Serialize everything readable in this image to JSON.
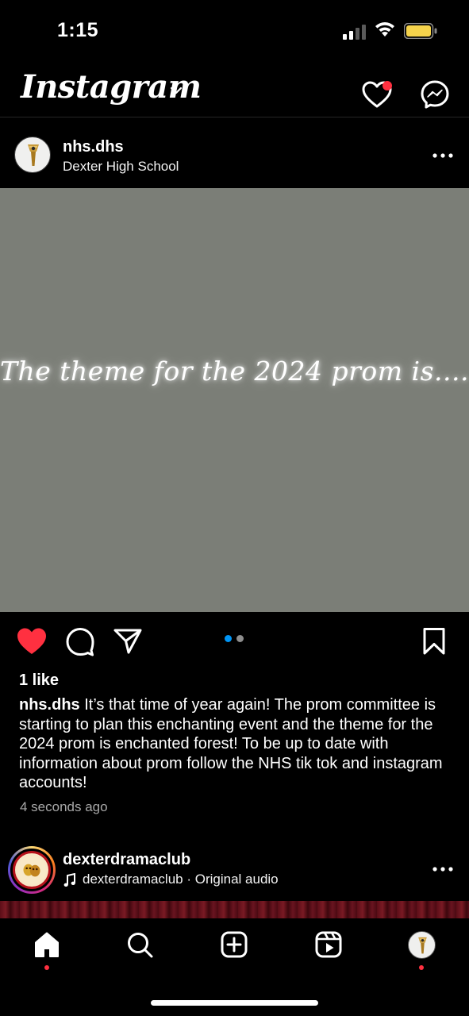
{
  "status_bar": {
    "time": "1:15"
  },
  "header": {
    "logo_text": "Instagram",
    "icons": [
      "chevron-down-icon",
      "heart-icon",
      "messenger-icon"
    ],
    "has_notification": true
  },
  "post": {
    "username": "nhs.dhs",
    "location": "Dexter High School",
    "image_text": "The theme for the 2024 prom is....",
    "image_bg_color": "#7b7e77",
    "liked": true,
    "carousel": {
      "current": 1,
      "total": 2
    },
    "likes": "1 like",
    "caption_username": "nhs.dhs",
    "caption_text": " It’s that time of year again! The prom committee is starting to plan this enchanting event and the theme for the 2024 prom is enchanted forest! To be up to date with information about prom follow the NHS tik tok and instagram accounts!",
    "timestamp": "4 seconds ago"
  },
  "next_post": {
    "username": "dexterdramaclub",
    "audio": "dexterdramaclub · Original audio"
  },
  "tab_bar": {
    "tabs": [
      "home-icon",
      "search-icon",
      "create-icon",
      "reels-icon",
      "profile-avatar"
    ],
    "active": "home-icon"
  },
  "colors": {
    "like_red": "#ff3040",
    "carousel_active": "#0095f6",
    "battery_fill": "#f5d34c"
  }
}
